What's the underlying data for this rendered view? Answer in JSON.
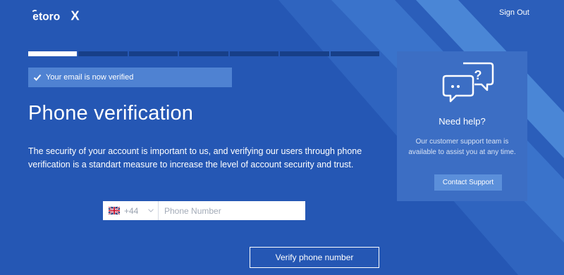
{
  "brand": {
    "logo_text": "eToroX"
  },
  "header": {
    "sign_out_label": "Sign Out"
  },
  "progress": {
    "total_steps": 7,
    "completed_steps": 1
  },
  "notice": {
    "text": "Your email is now verified"
  },
  "main": {
    "title": "Phone verification",
    "description": "The security of your account is important to us, and verifying our users through phone verification is a standart measure to increase the level of account security and trust.",
    "phone": {
      "country_flag": "uk-flag-icon",
      "dial_code": "+44",
      "placeholder": "Phone Number",
      "value": ""
    },
    "verify_button_label": "Verify phone number"
  },
  "help": {
    "title": "Need help?",
    "text": "Our customer support team is available to assist you at any time.",
    "contact_button_label": "Contact Support"
  },
  "colors": {
    "background": "#2557b4",
    "stripe": "#4a86d6",
    "progress_track": "#173f88",
    "notice_bg": "#4f82d2",
    "card_bg": "#3c6ec4",
    "button_bg": "#5b8fda"
  }
}
